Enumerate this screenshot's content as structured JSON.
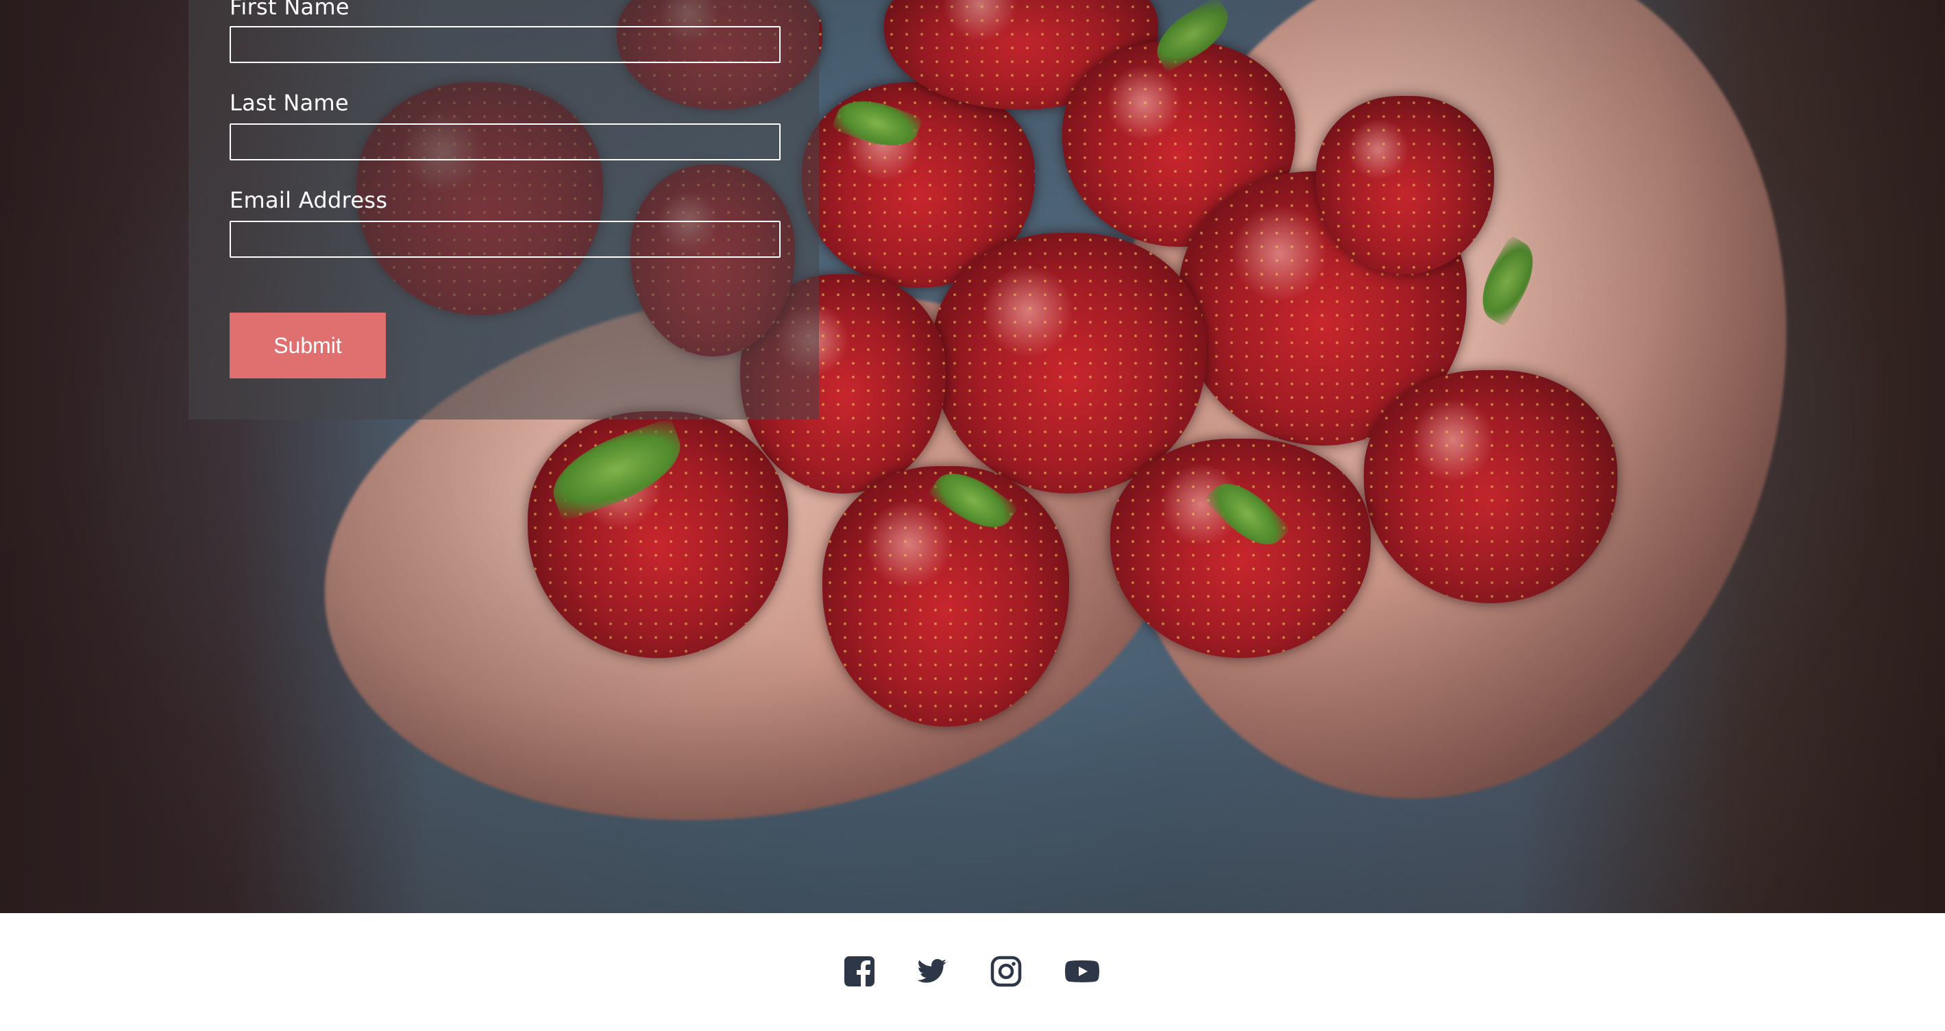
{
  "form": {
    "first_name_label": "First Name",
    "first_name_value": "",
    "last_name_label": "Last Name",
    "last_name_value": "",
    "email_label": "Email Address",
    "email_value": "",
    "submit_label": "Submit"
  },
  "footer": {
    "social_icons": [
      "facebook-icon",
      "twitter-icon",
      "instagram-icon",
      "youtube-icon"
    ]
  },
  "colors": {
    "submit_button": "#e07070",
    "footer_icons": "#2d3748",
    "footer_bg": "#ffffff"
  }
}
